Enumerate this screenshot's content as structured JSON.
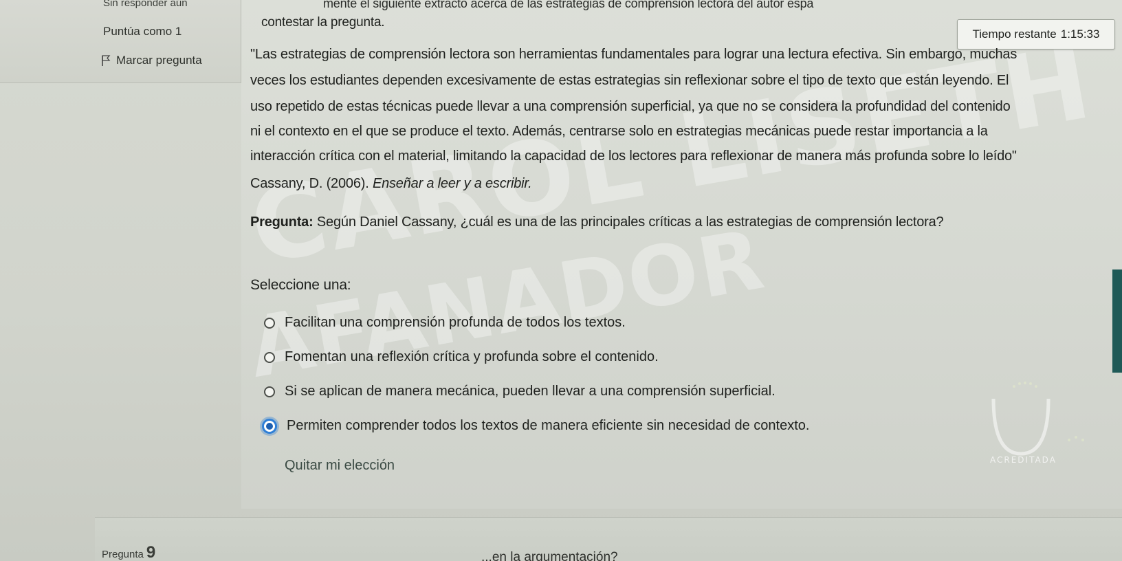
{
  "question_info": {
    "status": "Sin responder aún",
    "score": "Puntúa como 1",
    "flag_label": "Marcar pregunta"
  },
  "timer": {
    "label": "Tiempo restante",
    "value": "1:15:33"
  },
  "passage": {
    "intro_fragment": "mente el siguiente extracto acerca de las estrategias de comprensión lectora del autor espa",
    "intro_end": "contestar la pregunta.",
    "lines": [
      "\"Las estrategias de comprensión lectora son herramientas fundamentales para lograr una lectura efectiva. Sin embargo, muchas",
      "veces los estudiantes dependen excesivamente de estas estrategias sin reflexionar sobre el tipo de texto que están leyendo. El",
      "uso repetido de estas técnicas puede llevar a una comprensión superficial, ya que no se considera la profundidad del contenido",
      "ni el contexto en el que se produce el texto. Además, centrarse solo en estrategias mecánicas puede restar importancia a la",
      "interacción crítica con el material, limitando la capacidad de los lectores para reflexionar de manera más profunda sobre lo leído\""
    ],
    "citation_author": "Cassany, D. (2006). ",
    "citation_title": "Enseñar a leer y a escribir."
  },
  "question": {
    "label": "Pregunta:",
    "text": " Según Daniel Cassany, ¿cuál es una de las principales críticas a las estrategias de comprensión lectora?"
  },
  "answer": {
    "prompt": "Seleccione una:",
    "options": [
      {
        "text": "Facilitan una comprensión profunda de todos los textos.",
        "selected": false
      },
      {
        "text": "Fomentan una reflexión crítica y profunda sobre el contenido.",
        "selected": false
      },
      {
        "text": "Si se aplican de manera mecánica, pueden llevar a una comprensión superficial.",
        "selected": false
      },
      {
        "text": "Permiten comprender todos los textos de manera eficiente sin necesidad de contexto.",
        "selected": true
      }
    ],
    "clear_label": "Quitar mi elección"
  },
  "watermark": {
    "line1": "CAROL LISETH CALA",
    "line2": "AFANADOR"
  },
  "logo": {
    "name": "UNAD",
    "subtitle": "ACREDITADA"
  },
  "next_question": {
    "label": "Pregunta",
    "number": "9",
    "fragment": "...en la argumentación?"
  },
  "colors": {
    "selected_radio": "#2f7fd6",
    "background": "#d6d9d2",
    "edge_tab": "#1f5a57"
  }
}
